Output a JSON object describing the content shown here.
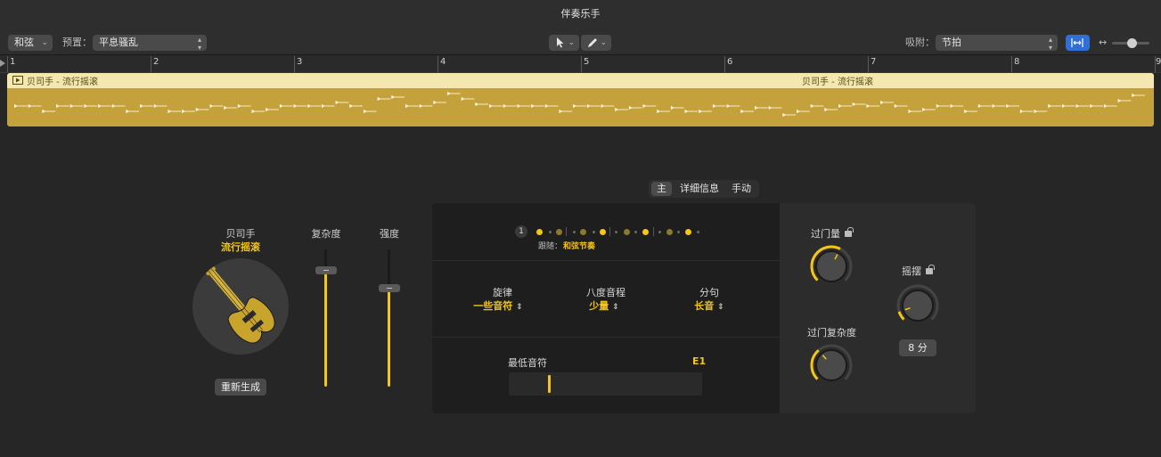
{
  "window": {
    "title": "伴奏乐手"
  },
  "toolbar": {
    "chord_menu": "和弦",
    "preset_label": "预置：",
    "preset_value": "平息骚乱",
    "snap_label": "吸附：",
    "snap_value": "节拍"
  },
  "ruler": {
    "bars": [
      "1",
      "2",
      "3",
      "4",
      "5",
      "6",
      "7",
      "8",
      "9"
    ]
  },
  "region": {
    "name_1": "贝司手 - 流行摇滚",
    "name_2": "贝司手 - 流行摇滚",
    "color": "#c5a13b"
  },
  "tabs": [
    "主",
    "详细信息",
    "手动"
  ],
  "player": {
    "name": "贝司手",
    "style": "流行摇滚",
    "regenerate": "重新生成"
  },
  "sliders": {
    "complexity": {
      "label": "复杂度",
      "value": 0.85
    },
    "intensity": {
      "label": "强度",
      "value": 0.72
    }
  },
  "pattern": {
    "number": "1",
    "follow_label": "跟随：",
    "follow_value": "和弦节奏"
  },
  "params": {
    "melody": {
      "title": "旋律",
      "value": "一些音符"
    },
    "octave": {
      "title": "八度音程",
      "value": "少量"
    },
    "phrase": {
      "title": "分句",
      "value": "长音"
    }
  },
  "lowest_note": {
    "label": "最低音符",
    "value": "E1"
  },
  "knobs": {
    "fill_amount": {
      "label": "过门量",
      "value": 0.6
    },
    "fill_complexity": {
      "label": "过门复杂度",
      "value": 0.35
    },
    "swing": {
      "label": "摇摆",
      "value": 0.1
    }
  },
  "swing_value": "8 分",
  "colors": {
    "accent": "#f5c518",
    "snap_button": "#2f6fd6"
  }
}
